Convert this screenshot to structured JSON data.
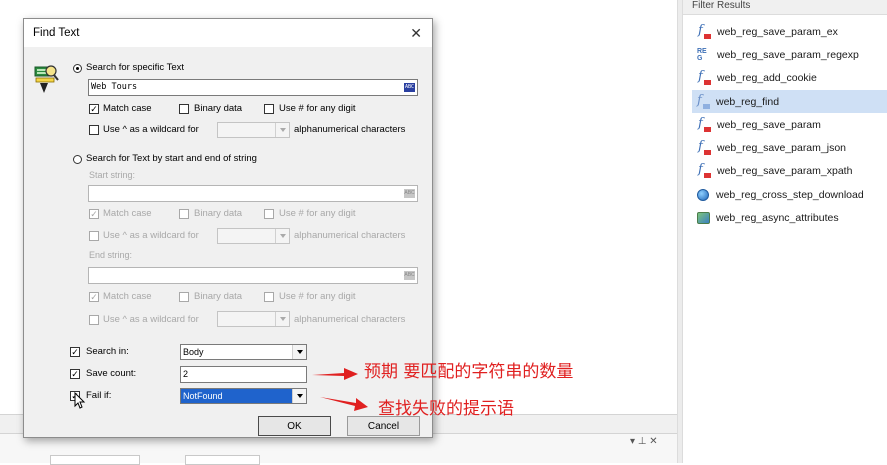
{
  "filter_panel": {
    "header": "Filter Results",
    "items": [
      {
        "label": "web_reg_save_param_ex",
        "icon": "function-icon"
      },
      {
        "label": "web_reg_save_param_regexp",
        "icon": "regex-icon"
      },
      {
        "label": "web_reg_add_cookie",
        "icon": "function-icon"
      },
      {
        "label": "web_reg_find",
        "icon": "function-icon",
        "selected": true
      },
      {
        "label": "web_reg_save_param",
        "icon": "function-icon"
      },
      {
        "label": "web_reg_save_param_json",
        "icon": "function-icon"
      },
      {
        "label": "web_reg_save_param_xpath",
        "icon": "function-icon"
      },
      {
        "label": "web_reg_cross_step_download",
        "icon": "globe-icon"
      },
      {
        "label": "web_reg_async_attributes",
        "icon": "async-icon"
      }
    ]
  },
  "dialog": {
    "title": "Find Text",
    "close_glyph": "✕",
    "specific": {
      "radio_label": "Search for specific Text",
      "text_value": "Web Tours",
      "abc_glyph": "ABC",
      "match_case": "Match case",
      "binary_data": "Binary data",
      "any_digit": "Use # for any digit",
      "wildcard": "Use ^ as a wildcard for",
      "alphanumeric": "alphanumerical characters"
    },
    "start_end": {
      "radio_label": "Search for Text by start and end of string",
      "start_label": "Start string:",
      "end_label": "End string:",
      "match_case": "Match case",
      "binary_data": "Binary data",
      "any_digit": "Use # for any digit",
      "wildcard": "Use ^ as a wildcard for",
      "alphanumeric": "alphanumerical characters"
    },
    "search_in": {
      "label": "Search in:",
      "value": "Body"
    },
    "save_count": {
      "label": "Save count:",
      "value": "2"
    },
    "fail_if": {
      "label": "Fail if:",
      "value": "NotFound"
    },
    "ok_label": "OK",
    "cancel_label": "Cancel"
  },
  "annotations": {
    "save_count_note": "预期 要匹配的字符串的数量",
    "fail_if_note": "查找失败的提示语",
    "color": "#e02020"
  },
  "bottom_bar": {
    "pin_glyphs": "▾ ⊥ ✕"
  }
}
